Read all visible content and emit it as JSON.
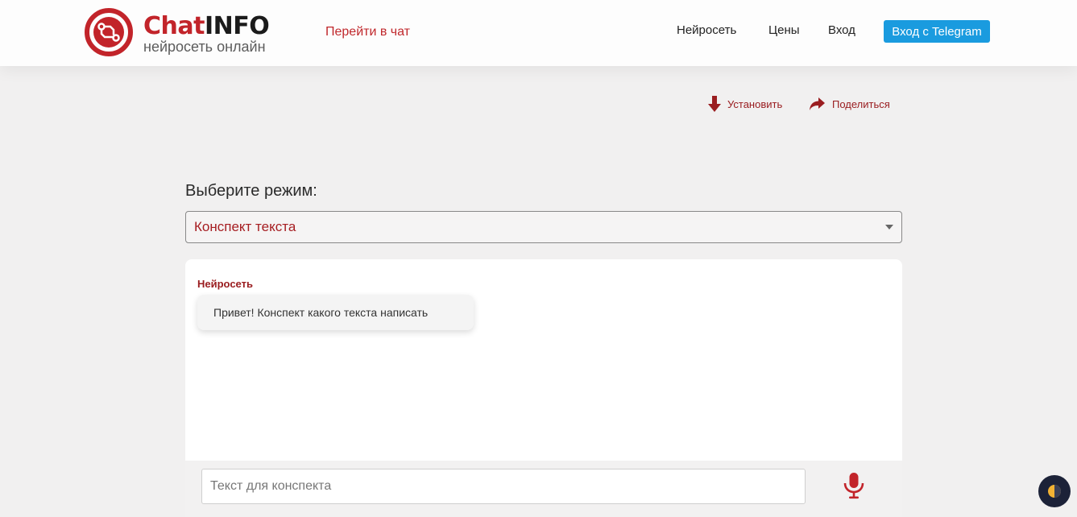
{
  "header": {
    "logo": {
      "brand_part1": "Chat",
      "brand_part2": "INFO",
      "tagline": "нейросеть онлайн",
      "icon": "circuit-logo-icon"
    },
    "go_to_chat": "Перейти в чат",
    "nav": {
      "neural": "Нейросеть",
      "prices": "Цены",
      "login": "Вход"
    },
    "telegram_button": "Вход с Telegram"
  },
  "actions": {
    "install": {
      "label": "Установить",
      "icon": "download-arrow-icon"
    },
    "share": {
      "label": "Поделиться",
      "icon": "share-arrow-icon"
    }
  },
  "mode": {
    "label": "Выберите режим:",
    "selected": "Конспект текста"
  },
  "chat": {
    "messages": [
      {
        "sender": "Нейросеть",
        "text": "Привет! Конспект какого текста написать"
      }
    ],
    "input_placeholder": "Текст для конспекта",
    "input_value": "",
    "mic_icon": "microphone-icon"
  },
  "theme_toggle": {
    "icon": "half-moon-icon"
  },
  "colors": {
    "brand_red": "#c2242a",
    "accent_dark_red": "#9a1d20",
    "telegram_blue": "#1a9bdf",
    "page_bg": "#f1f0f0"
  }
}
